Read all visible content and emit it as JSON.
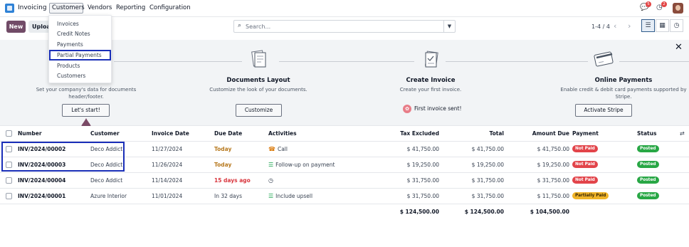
{
  "app": {
    "name": "Invoicing"
  },
  "nav": {
    "menus": [
      "Customers",
      "Vendors",
      "Reporting",
      "Configuration"
    ],
    "chat_count": "5",
    "activity_count": "2"
  },
  "toolbar": {
    "new_label": "New",
    "upload_label": "Upload",
    "search_placeholder": "Search...",
    "pager": "1-4 / 4"
  },
  "dropdown": {
    "items": [
      "Invoices",
      "Credit Notes",
      "Payments",
      "Partial Payments",
      "Products",
      "Customers"
    ]
  },
  "onboarding": {
    "step1": {
      "desc": "Set your company's data for documents header/footer.",
      "button": "Let's start!"
    },
    "step2": {
      "title": "Documents Layout",
      "desc": "Customize the look of your documents.",
      "button": "Customize"
    },
    "step3": {
      "title": "Create Invoice",
      "desc": "Create your first invoice.",
      "done": "First invoice sent!"
    },
    "step4": {
      "title": "Online Payments",
      "desc": "Enable credit & debit card payments supported by Stripe.",
      "button": "Activate Stripe"
    }
  },
  "table": {
    "headers": [
      "Number",
      "Customer",
      "Invoice Date",
      "Due Date",
      "Activities",
      "Tax Excluded",
      "Total",
      "Amount Due",
      "Payment",
      "Status"
    ],
    "rows": [
      {
        "number": "INV/2024/00002",
        "customer": "Deco Addict",
        "invoice_date": "11/27/2024",
        "due_date": "Today",
        "activity": "Call",
        "tax_excluded": "$ 41,750.00",
        "total": "$ 41,750.00",
        "amount_due": "$ 41,750.00",
        "payment": "Not Paid",
        "status": "Posted"
      },
      {
        "number": "INV/2024/00003",
        "customer": "Deco Addict",
        "invoice_date": "11/26/2024",
        "due_date": "Today",
        "activity": "Follow-up on payment",
        "tax_excluded": "$ 19,250.00",
        "total": "$ 19,250.00",
        "amount_due": "$ 19,250.00",
        "payment": "Not Paid",
        "status": "Posted"
      },
      {
        "number": "INV/2024/00004",
        "customer": "Deco Addict",
        "invoice_date": "11/14/2024",
        "due_date": "15 days ago",
        "activity": "",
        "tax_excluded": "$ 31,750.00",
        "total": "$ 31,750.00",
        "amount_due": "$ 31,750.00",
        "payment": "Not Paid",
        "status": "Posted"
      },
      {
        "number": "INV/2024/00001",
        "customer": "Azure Interior",
        "invoice_date": "11/01/2024",
        "due_date": "In 32 days",
        "activity": "Include upsell",
        "tax_excluded": "$ 31,750.00",
        "total": "$ 31,750.00",
        "amount_due": "$ 11,750.00",
        "payment": "Partially Paid",
        "status": "Posted"
      }
    ],
    "totals": {
      "tax_excluded": "$ 124,500.00",
      "total": "$ 124,500.00",
      "amount_due": "$ 104,500.00"
    }
  },
  "colors": {
    "brand": "#714b67",
    "highlight": "#1a2fb8",
    "not_paid": "#e2444a",
    "partial": "#f0b429",
    "posted": "#28a745"
  }
}
